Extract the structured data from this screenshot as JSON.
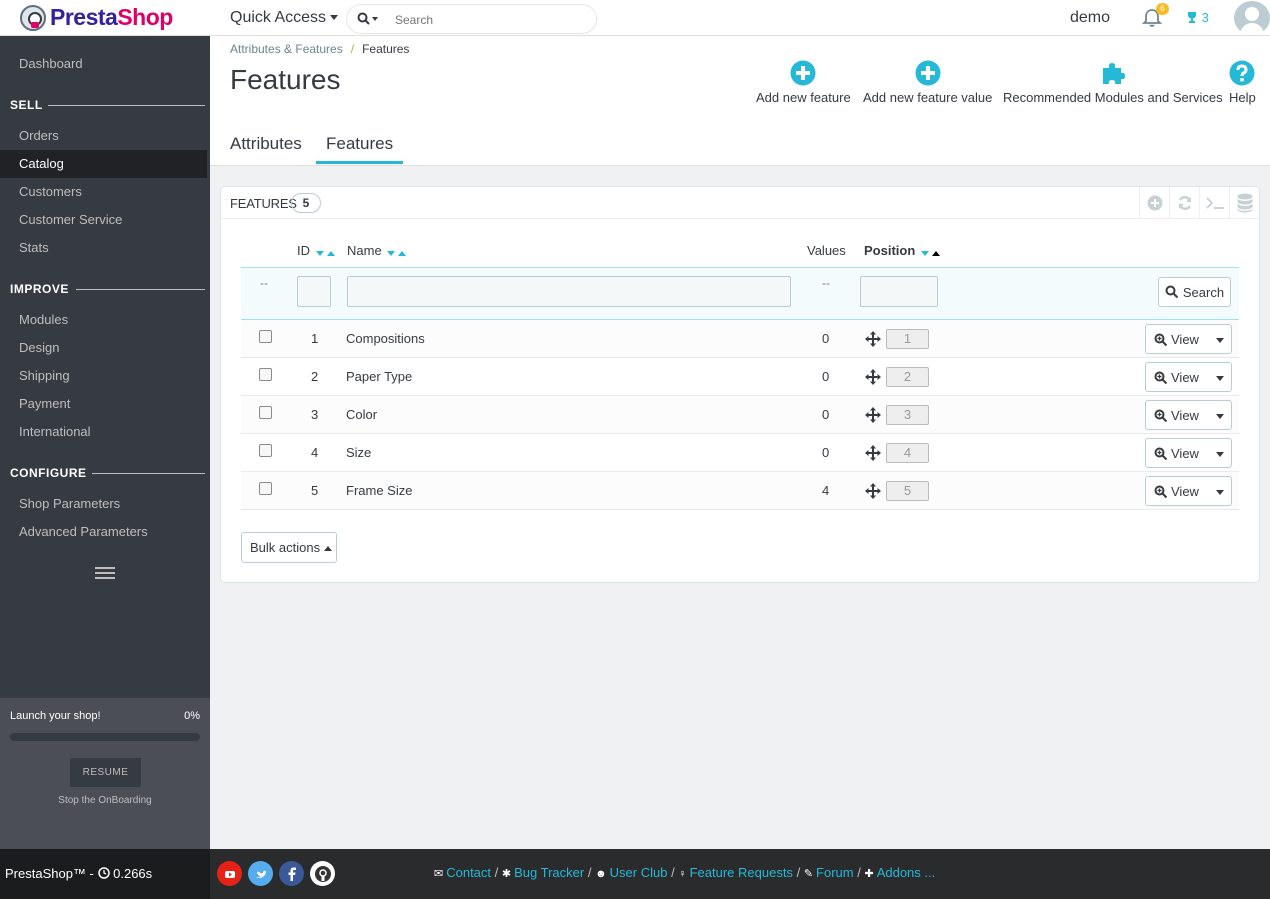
{
  "header": {
    "logo_prefix": "Presta",
    "logo_suffix": "Shop",
    "quick_access": "Quick Access",
    "search_placeholder": "Search",
    "user": "demo",
    "notifications_count": "6",
    "trophy_count": "3"
  },
  "sidebar": {
    "dashboard": "Dashboard",
    "sections": {
      "sell": "SELL",
      "improve": "IMPROVE",
      "configure": "CONFIGURE"
    },
    "sell_items": [
      "Orders",
      "Catalog",
      "Customers",
      "Customer Service",
      "Stats"
    ],
    "improve_items": [
      "Modules",
      "Design",
      "Shipping",
      "Payment",
      "International"
    ],
    "configure_items": [
      "Shop Parameters",
      "Advanced Parameters"
    ],
    "active_item": "Catalog",
    "onboarding": {
      "label": "Launch your shop!",
      "percent": "0%",
      "progress": 0,
      "resume": "RESUME",
      "stop": "Stop the OnBoarding"
    }
  },
  "page": {
    "breadcrumb_parent": "Attributes & Features",
    "breadcrumb_current": "Features",
    "title": "Features",
    "toolbar": {
      "add_feature": "Add new feature",
      "add_feature_value": "Add new feature value",
      "recommended": "Recommended Modules and Services",
      "help": "Help"
    },
    "tabs": [
      "Attributes",
      "Features"
    ],
    "active_tab": "Features"
  },
  "panel": {
    "title": "FEATURES",
    "count": "5",
    "columns": {
      "id": "ID",
      "name": "Name",
      "values": "Values",
      "position": "Position"
    },
    "filter_dash": "--",
    "search_button": "Search",
    "rows": [
      {
        "id": "1",
        "name": "Compositions",
        "values": "0",
        "position": "1"
      },
      {
        "id": "2",
        "name": "Paper Type",
        "values": "0",
        "position": "2"
      },
      {
        "id": "3",
        "name": "Color",
        "values": "0",
        "position": "3"
      },
      {
        "id": "4",
        "name": "Size",
        "values": "0",
        "position": "4"
      },
      {
        "id": "5",
        "name": "Frame Size",
        "values": "4",
        "position": "5"
      }
    ],
    "view_label": "View",
    "bulk_actions": "Bulk actions"
  },
  "footer": {
    "brand": "PrestaShop™ - ",
    "timing": "0.266s",
    "links": [
      "Contact",
      "Bug Tracker",
      "User Club",
      "Feature Requests",
      "Forum",
      "Addons ..."
    ],
    "separator": "/"
  },
  "colors": {
    "accent": "#25b9d7",
    "sidebar": "#363a41",
    "footer": "#2a2b2d"
  }
}
